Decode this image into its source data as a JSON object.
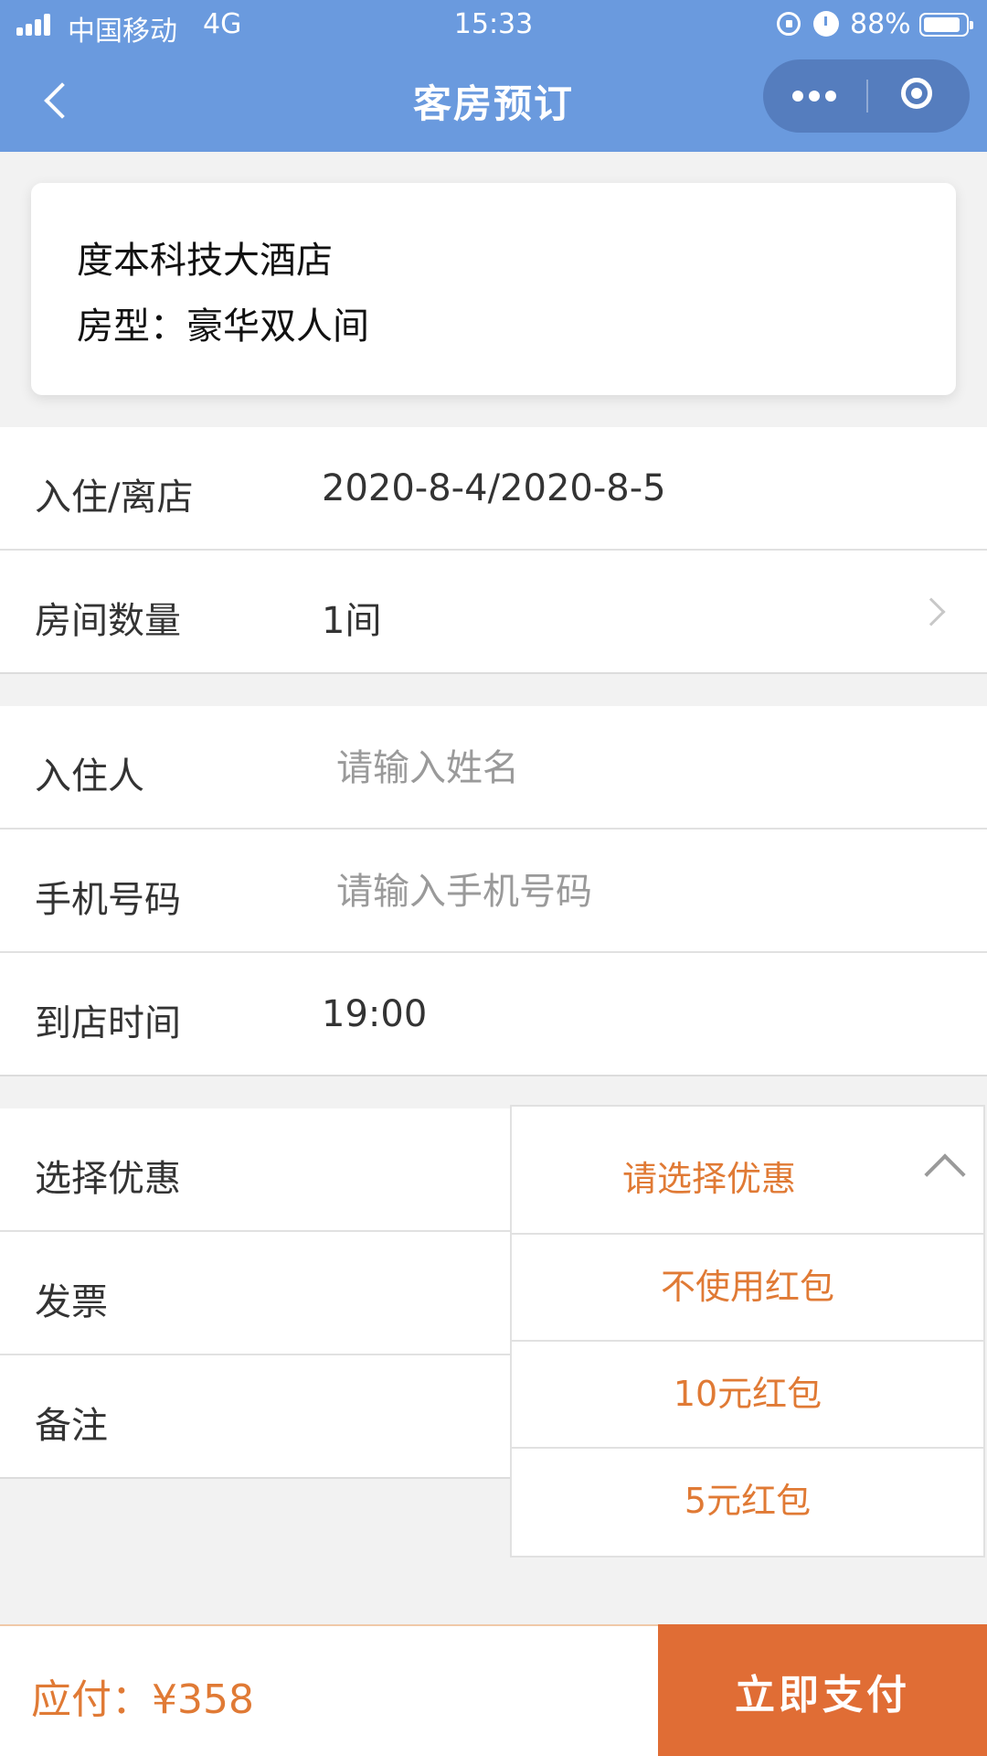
{
  "status_bar": {
    "carrier": "中国移动",
    "network": "4G",
    "time": "15:33",
    "battery_percent": "88%",
    "battery_level": 0.88,
    "icons": [
      "signal-icon",
      "lock-icon",
      "alarm-icon",
      "battery-icon"
    ]
  },
  "nav": {
    "title": "客房预订",
    "back_icon": "chevron-left-icon",
    "menu_icons": [
      "more-icon",
      "target-icon"
    ]
  },
  "hotel": {
    "name": "度本科技大酒店",
    "room_type": "房型：豪华双人间"
  },
  "booking": {
    "checkin_label": "入住/离店",
    "checkin_value": "2020-8-4/2020-8-5",
    "rooms_label": "房间数量",
    "rooms_value": "1间"
  },
  "guest": {
    "name_label": "入住人",
    "name_placeholder": "请输入姓名",
    "name_value": "",
    "phone_label": "手机号码",
    "phone_placeholder": "请输入手机号码",
    "phone_value": "",
    "arrival_label": "到店时间",
    "arrival_value": "19:00"
  },
  "extras": {
    "discount_label": "选择优惠",
    "invoice_label": "发票",
    "remark_label": "备注"
  },
  "discount_dropdown": {
    "prompt": "请选择优惠",
    "options": [
      "不使用红包",
      "10元红包",
      "5元红包"
    ]
  },
  "footer": {
    "amount_text": "应付：¥358",
    "pay_label": "立即支付"
  },
  "colors": {
    "header_bg": "#6a9ade",
    "accent": "#e07a35",
    "pay_button": "#e06d35"
  }
}
